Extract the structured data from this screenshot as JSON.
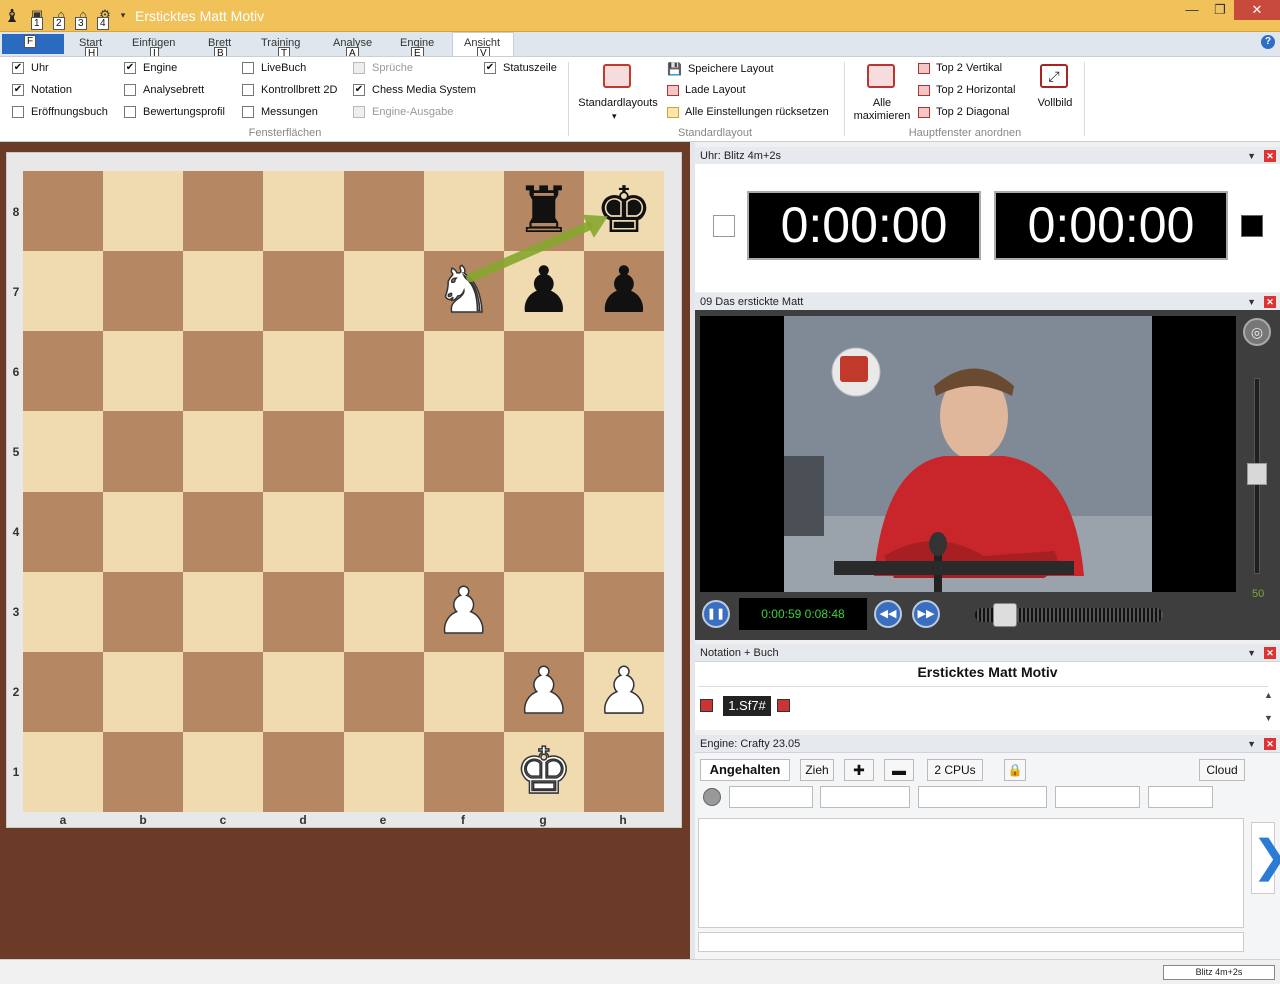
{
  "window": {
    "title": "Ersticktes Matt Motiv",
    "quick_access_keytips": [
      "1",
      "2",
      "3",
      "4"
    ]
  },
  "ribbon": {
    "file_keytip": "F",
    "tabs": [
      {
        "label": "Start",
        "keytip": "H"
      },
      {
        "label": "Einfügen",
        "keytip": "I"
      },
      {
        "label": "Brett",
        "keytip": "B"
      },
      {
        "label": "Training",
        "keytip": "T"
      },
      {
        "label": "Analyse",
        "keytip": "A"
      },
      {
        "label": "Engine",
        "keytip": "E"
      },
      {
        "label": "Ansicht",
        "keytip": "V"
      }
    ],
    "active_tab": "Ansicht",
    "fensterflaechen": {
      "group_label": "Fensterflächen",
      "checkboxes": [
        {
          "label": "Uhr",
          "checked": true,
          "enabled": true
        },
        {
          "label": "Notation",
          "checked": true,
          "enabled": true
        },
        {
          "label": "Eröffnungsbuch",
          "checked": false,
          "enabled": true
        },
        {
          "label": "Engine",
          "checked": true,
          "enabled": true
        },
        {
          "label": "Analysebrett",
          "checked": false,
          "enabled": true
        },
        {
          "label": "Bewertungsprofil",
          "checked": false,
          "enabled": true
        },
        {
          "label": "LiveBuch",
          "checked": false,
          "enabled": true
        },
        {
          "label": "Kontrollbrett 2D",
          "checked": false,
          "enabled": true
        },
        {
          "label": "Messungen",
          "checked": false,
          "enabled": true
        },
        {
          "label": "Sprüche",
          "checked": false,
          "enabled": false
        },
        {
          "label": "Chess Media System",
          "checked": true,
          "enabled": true
        },
        {
          "label": "Engine-Ausgabe",
          "checked": false,
          "enabled": false
        },
        {
          "label": "Statuszeile",
          "checked": true,
          "enabled": true
        }
      ]
    },
    "standardlayout": {
      "group_label": "Standardlayout",
      "big_button": "Standardlayouts",
      "buttons": [
        "Speichere Layout",
        "Lade Layout",
        "Alle Einstellungen rücksetzen"
      ]
    },
    "hauptfenster": {
      "group_label": "Hauptfenster anordnen",
      "maximize_label_1": "Alle",
      "maximize_label_2": "maximieren",
      "buttons": [
        "Top 2 Vertikal",
        "Top 2 Horizontal",
        "Top 2 Diagonal"
      ],
      "fullscreen_label": "Vollbild"
    }
  },
  "board": {
    "ranks": [
      "8",
      "7",
      "6",
      "5",
      "4",
      "3",
      "2",
      "1"
    ],
    "files": [
      "a",
      "b",
      "c",
      "d",
      "e",
      "f",
      "g",
      "h"
    ],
    "pieces": [
      {
        "square": "g8",
        "piece": "rook",
        "color": "black"
      },
      {
        "square": "h8",
        "piece": "king",
        "color": "black"
      },
      {
        "square": "f7",
        "piece": "knight",
        "color": "white"
      },
      {
        "square": "g7",
        "piece": "pawn",
        "color": "black"
      },
      {
        "square": "h7",
        "piece": "pawn",
        "color": "black"
      },
      {
        "square": "f3",
        "piece": "pawn",
        "color": "white"
      },
      {
        "square": "g2",
        "piece": "pawn",
        "color": "white"
      },
      {
        "square": "h2",
        "piece": "pawn",
        "color": "white"
      },
      {
        "square": "g1",
        "piece": "king",
        "color": "white"
      }
    ],
    "arrow": {
      "from": "f7",
      "to": "h8",
      "color": "#86a62e"
    },
    "light_color": "#f0dab0",
    "dark_color": "#b58863"
  },
  "clock_panel": {
    "title": "Uhr: Blitz 4m+2s",
    "white_time": "0:00:00",
    "black_time": "0:00:00"
  },
  "video_panel": {
    "title": "09 Das erstickte Matt",
    "time": "0:00:59 0:08:48",
    "volume": "50",
    "progress_fraction": 0.11
  },
  "notation_panel": {
    "title": "Notation + Buch",
    "game_title": "Ersticktes Matt Motiv",
    "moves": [
      "1.Sf7#"
    ]
  },
  "engine_panel": {
    "title": "Engine: Crafty 23.05",
    "buttons": [
      "Angehalten",
      "Zieh",
      "2 CPUs",
      "Cloud"
    ],
    "next_glyph": "❯"
  },
  "status_bar": {
    "text": "Blitz 4m+2s"
  }
}
